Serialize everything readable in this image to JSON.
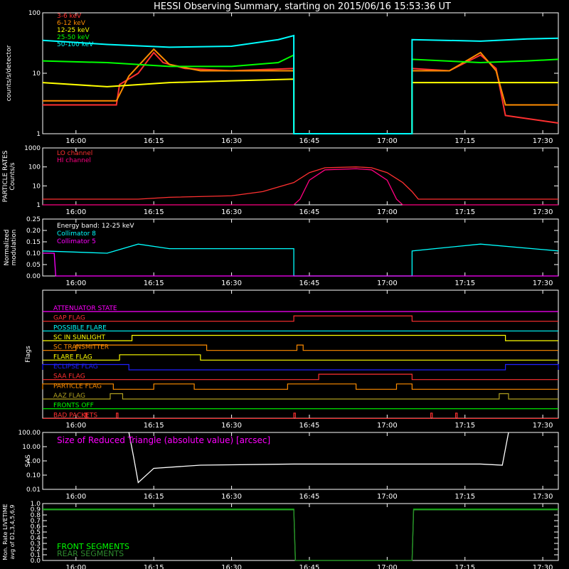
{
  "title": "HESSI Observing Summary, starting on 2015/06/16 15:53:36 UT",
  "time_ticks": [
    "16:00",
    "16:15",
    "16:30",
    "16:45",
    "17:00",
    "17:15",
    "17:30"
  ],
  "colors": {
    "white": "#ffffff",
    "red": "#ff3030",
    "orange": "#ff8c00",
    "yellow": "#ffff00",
    "green": "#00ff00",
    "cyan": "#00ffff",
    "magenta": "#ff00ff",
    "blue": "#2020ff",
    "olive": "#b0a020"
  },
  "chart_data": [
    {
      "type": "line",
      "id": "count_rates",
      "ylabel": "counts/s/detector",
      "yscale": "log",
      "ylim": [
        1,
        100
      ],
      "yticks": [
        "1",
        "10",
        "100"
      ],
      "series": [
        {
          "name": "3-6 keV",
          "color": "#ff3030",
          "gaps": [
            [
              16.7,
              17.08
            ]
          ],
          "points": [
            [
              15.893,
              3
            ],
            [
              16.13,
              3
            ],
            [
              16.14,
              6.5
            ],
            [
              16.2,
              10
            ],
            [
              16.25,
              22
            ],
            [
              16.28,
              15
            ],
            [
              16.35,
              12
            ],
            [
              16.5,
              11
            ],
            [
              16.7,
              12
            ],
            [
              17.08,
              12
            ],
            [
              17.2,
              11
            ],
            [
              17.3,
              20
            ],
            [
              17.35,
              12
            ],
            [
              17.38,
              2
            ],
            [
              17.55,
              1.5
            ]
          ]
        },
        {
          "name": "6-12 keV",
          "color": "#ff8c00",
          "gaps": [
            [
              16.7,
              17.08
            ]
          ],
          "points": [
            [
              15.893,
              3.5
            ],
            [
              16.0,
              3.5
            ],
            [
              16.13,
              3.5
            ],
            [
              16.17,
              9
            ],
            [
              16.25,
              25
            ],
            [
              16.3,
              14
            ],
            [
              16.4,
              11
            ],
            [
              16.55,
              11
            ],
            [
              16.7,
              11
            ],
            [
              17.08,
              11
            ],
            [
              17.2,
              11
            ],
            [
              17.3,
              22
            ],
            [
              17.35,
              11
            ],
            [
              17.38,
              3
            ],
            [
              17.55,
              3
            ]
          ]
        },
        {
          "name": "12-25 keV",
          "color": "#ffff00",
          "gaps": [
            [
              16.7,
              17.08
            ]
          ],
          "points": [
            [
              15.893,
              7
            ],
            [
              16.1,
              6
            ],
            [
              16.3,
              7
            ],
            [
              16.5,
              7.5
            ],
            [
              16.7,
              8
            ],
            [
              17.08,
              7
            ],
            [
              17.3,
              7
            ],
            [
              17.55,
              7
            ]
          ]
        },
        {
          "name": "25-50 keV",
          "color": "#00ff00",
          "gaps": [
            [
              16.7,
              17.08
            ]
          ],
          "points": [
            [
              15.893,
              16
            ],
            [
              16.1,
              15
            ],
            [
              16.3,
              13
            ],
            [
              16.5,
              13
            ],
            [
              16.65,
              15
            ],
            [
              16.7,
              20
            ],
            [
              17.08,
              17
            ],
            [
              17.3,
              15
            ],
            [
              17.45,
              16
            ],
            [
              17.55,
              17
            ]
          ]
        },
        {
          "name": "50-100 keV",
          "color": "#00ffff",
          "gaps": [
            [
              16.7,
              17.08
            ]
          ],
          "points": [
            [
              15.893,
              35
            ],
            [
              16.1,
              30
            ],
            [
              16.3,
              27
            ],
            [
              16.5,
              28
            ],
            [
              16.65,
              36
            ],
            [
              16.7,
              42
            ],
            [
              17.08,
              36
            ],
            [
              17.3,
              34
            ],
            [
              17.45,
              37
            ],
            [
              17.55,
              38
            ]
          ]
        }
      ]
    },
    {
      "type": "line",
      "id": "particle_rates",
      "ylabel": "PARTICLE RATES Counts/s",
      "yscale": "log",
      "ylim": [
        1,
        1000
      ],
      "yticks": [
        "1",
        "10",
        "100",
        "1000"
      ],
      "series": [
        {
          "name": "LO channel",
          "color": "#ff3030",
          "points": [
            [
              15.893,
              2
            ],
            [
              16.2,
              2
            ],
            [
              16.3,
              2.5
            ],
            [
              16.5,
              3
            ],
            [
              16.6,
              5
            ],
            [
              16.7,
              15
            ],
            [
              16.75,
              50
            ],
            [
              16.8,
              90
            ],
            [
              16.9,
              100
            ],
            [
              16.95,
              90
            ],
            [
              17.0,
              50
            ],
            [
              17.05,
              15
            ],
            [
              17.08,
              5
            ],
            [
              17.1,
              2
            ],
            [
              17.55,
              2
            ]
          ]
        },
        {
          "name": "HI channel",
          "color": "#ff0080",
          "points": [
            [
              15.893,
              1
            ],
            [
              16.7,
              1
            ],
            [
              16.72,
              2
            ],
            [
              16.75,
              20
            ],
            [
              16.8,
              70
            ],
            [
              16.9,
              80
            ],
            [
              16.95,
              70
            ],
            [
              17.0,
              20
            ],
            [
              17.03,
              2
            ],
            [
              17.05,
              1
            ],
            [
              17.55,
              1
            ]
          ]
        }
      ]
    },
    {
      "type": "line",
      "id": "modulation",
      "ylabel": "Normalized modulation",
      "yscale": "linear",
      "ylim": [
        0,
        0.25
      ],
      "yticks": [
        "0.00",
        "0.05",
        "0.10",
        "0.15",
        "0.20",
        "0.25"
      ],
      "annotation": "Energy band: 12-25 keV",
      "series": [
        {
          "name": "Collimator 8",
          "color": "#00ffff",
          "gaps": [
            [
              16.7,
              17.08
            ]
          ],
          "points": [
            [
              15.893,
              0.11
            ],
            [
              16.1,
              0.1
            ],
            [
              16.2,
              0.14
            ],
            [
              16.3,
              0.12
            ],
            [
              16.5,
              0.12
            ],
            [
              16.7,
              0.12
            ],
            [
              17.08,
              0.11
            ],
            [
              17.3,
              0.14
            ],
            [
              17.55,
              0.11
            ]
          ]
        },
        {
          "name": "Collimator 5",
          "color": "#ff00ff",
          "points": [
            [
              15.893,
              0.1
            ],
            [
              15.93,
              0.1
            ],
            [
              15.935,
              0
            ],
            [
              16.7,
              0
            ],
            [
              17.08,
              0
            ],
            [
              17.55,
              0
            ]
          ]
        }
      ]
    },
    {
      "type": "table",
      "id": "flags",
      "ylabel": "Flags",
      "flags": [
        {
          "name": "ATTENUATOR STATE",
          "color": "#ff00ff",
          "steps": []
        },
        {
          "name": "GAP FLAG",
          "color": "#ff3030",
          "steps": [
            [
              16.7,
              17.08
            ]
          ]
        },
        {
          "name": "POSSIBLE FLARE",
          "color": "#00ffff",
          "steps": []
        },
        {
          "name": "SC IN SUNLIGHT",
          "color": "#ffff00",
          "steps": [
            [
              16.18,
              17.38
            ]
          ]
        },
        {
          "name": "SC TRANSMITTER",
          "color": "#ff8c00",
          "steps": [
            [
              16.0,
              16.42
            ],
            [
              16.71,
              16.73
            ]
          ]
        },
        {
          "name": "FLARE FLAG",
          "color": "#ffff00",
          "steps": [
            [
              16.14,
              16.4
            ]
          ]
        },
        {
          "name": "ECLIPSE FLAG",
          "color": "#2020ff",
          "steps": [
            [
              15.893,
              16.17
            ],
            [
              17.38,
              17.55
            ]
          ]
        },
        {
          "name": "SAA FLAG",
          "color": "#ff3030",
          "steps": [
            [
              16.78,
              17.08
            ]
          ]
        },
        {
          "name": "PARTICLE FLAG",
          "color": "#ff8c00",
          "steps": [
            [
              15.893,
              16.12
            ],
            [
              16.25,
              16.38
            ],
            [
              16.68,
              16.9
            ],
            [
              17.03,
              17.08
            ]
          ]
        },
        {
          "name": "AAZ FLAG",
          "color": "#b0a020",
          "steps": [
            [
              16.11,
              16.15
            ],
            [
              17.36,
              17.39
            ]
          ]
        },
        {
          "name": "FRONTS OFF",
          "color": "#00ff00",
          "steps": []
        },
        {
          "name": "BAD PACKETS",
          "color": "#ff3030",
          "steps": [
            [
              16.03,
              16.035
            ],
            [
              16.13,
              16.135
            ],
            [
              16.7,
              16.705
            ],
            [
              17.14,
              17.145
            ],
            [
              17.22,
              17.225
            ]
          ]
        }
      ]
    },
    {
      "type": "line",
      "id": "sas",
      "ylabel": "SAS",
      "yscale": "log",
      "ylim": [
        0.01,
        100
      ],
      "yticks": [
        "0.01",
        "0.10",
        "1.00",
        "10.00",
        "100.00"
      ],
      "annotation": "Size of Reduced Triangle (absolute value) [arcsec]",
      "series": [
        {
          "name": "",
          "color": "#ffffff",
          "points": [
            [
              16.17,
              100
            ],
            [
              16.185,
              2
            ],
            [
              16.2,
              0.03
            ],
            [
              16.25,
              0.3
            ],
            [
              16.4,
              0.5
            ],
            [
              16.7,
              0.6
            ],
            [
              17.0,
              0.6
            ],
            [
              17.3,
              0.6
            ],
            [
              17.37,
              0.5
            ],
            [
              17.39,
              100
            ]
          ]
        }
      ]
    },
    {
      "type": "line",
      "id": "livetime",
      "ylabel": "Mon. Rate LIVETIME avg of D1,3,4,5,6,9",
      "yscale": "linear",
      "ylim": [
        0,
        1
      ],
      "yticks": [
        "0.0",
        "0.1",
        "0.2",
        "0.3",
        "0.4",
        "0.5",
        "0.6",
        "0.7",
        "0.8",
        "0.9",
        "1.0"
      ],
      "series": [
        {
          "name": "FRONT SEGMENTS",
          "color": "#00ff00",
          "points": [
            [
              15.893,
              0.9
            ],
            [
              16.7,
              0.9
            ],
            [
              16.705,
              0
            ],
            [
              17.08,
              0
            ],
            [
              17.085,
              0.9
            ],
            [
              17.55,
              0.9
            ]
          ]
        },
        {
          "name": "REAR SEGMENTS",
          "color": "#2e8b2e",
          "points": [
            [
              15.893,
              0.89
            ],
            [
              16.7,
              0.89
            ],
            [
              16.705,
              0
            ],
            [
              17.08,
              0
            ],
            [
              17.085,
              0.89
            ],
            [
              17.55,
              0.89
            ]
          ]
        }
      ]
    }
  ]
}
